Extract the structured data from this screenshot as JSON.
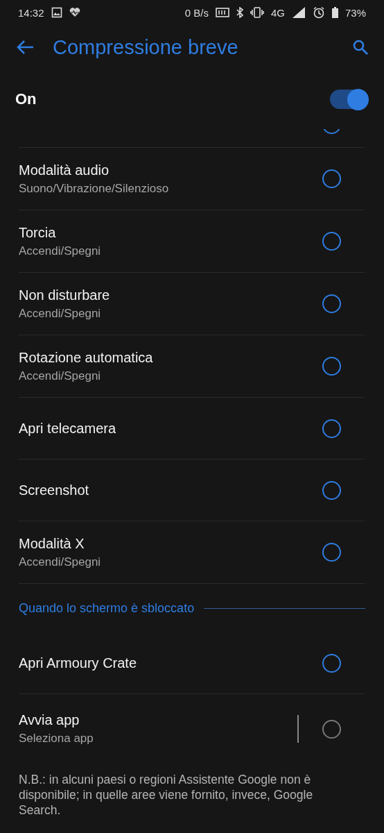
{
  "status_bar": {
    "time": "14:32",
    "speed": "0 B/s",
    "network": "4G",
    "battery": "73%"
  },
  "header": {
    "title": "Compressione breve"
  },
  "master": {
    "label": "On",
    "on": true
  },
  "items": [
    {
      "kind": "partial",
      "selected": false,
      "disabled": false
    },
    {
      "kind": "option",
      "title": "Modalità audio",
      "subtitle": "Suono/Vibrazione/Silenzioso",
      "selected": false,
      "disabled": false
    },
    {
      "kind": "option",
      "title": "Torcia",
      "subtitle": "Accendi/Spegni",
      "selected": false,
      "disabled": false
    },
    {
      "kind": "option",
      "title": "Non disturbare",
      "subtitle": "Accendi/Spegni",
      "selected": false,
      "disabled": false
    },
    {
      "kind": "option",
      "title": "Rotazione automatica",
      "subtitle": "Accendi/Spegni",
      "selected": false,
      "disabled": false
    },
    {
      "kind": "option",
      "title": "Apri telecamera",
      "selected": false,
      "disabled": false
    },
    {
      "kind": "option",
      "title": "Screenshot",
      "selected": false,
      "disabled": false
    },
    {
      "kind": "option",
      "title": "Modalità X",
      "subtitle": "Accendi/Spegni",
      "selected": false,
      "disabled": false
    },
    {
      "kind": "section",
      "title": "Quando lo schermo è sbloccato"
    },
    {
      "kind": "option",
      "title": "Apri Armoury Crate",
      "selected": false,
      "disabled": false
    },
    {
      "kind": "app",
      "title": "Avvia app",
      "subtitle": "Seleziona app",
      "selected": false,
      "disabled": true
    }
  ],
  "note": "N.B.: in alcuni paesi o regioni Assistente Google non è disponibile; in quelle aree viene fornito, invece, Google Search."
}
